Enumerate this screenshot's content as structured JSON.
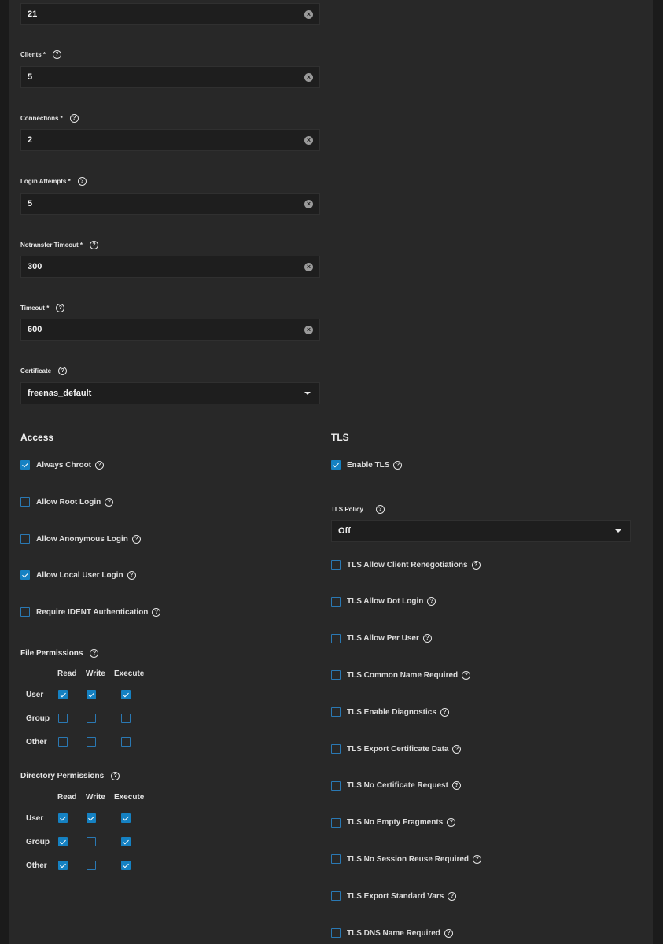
{
  "fields": {
    "port": {
      "value": "21"
    },
    "clients": {
      "label": "Clients *",
      "value": "5"
    },
    "connections": {
      "label": "Connections *",
      "value": "2"
    },
    "login_attempts": {
      "label": "Login Attempts *",
      "value": "5"
    },
    "notransfer_timeout": {
      "label": "Notransfer Timeout *",
      "value": "300"
    },
    "timeout": {
      "label": "Timeout *",
      "value": "600"
    },
    "certificate": {
      "label": "Certificate",
      "value": "freenas_default"
    }
  },
  "access": {
    "title": "Access",
    "always_chroot": {
      "label": "Always Chroot",
      "checked": true
    },
    "allow_root_login": {
      "label": "Allow Root Login",
      "checked": false
    },
    "allow_anonymous_login": {
      "label": "Allow Anonymous Login",
      "checked": false
    },
    "allow_local_user_login": {
      "label": "Allow Local User Login",
      "checked": true
    },
    "require_ident": {
      "label": "Require IDENT Authentication",
      "checked": false
    }
  },
  "file_permissions": {
    "label": "File Permissions",
    "columns": [
      "Read",
      "Write",
      "Execute"
    ],
    "rows": [
      {
        "name": "User",
        "values": [
          true,
          true,
          true
        ]
      },
      {
        "name": "Group",
        "values": [
          false,
          false,
          false
        ]
      },
      {
        "name": "Other",
        "values": [
          false,
          false,
          false
        ]
      }
    ]
  },
  "directory_permissions": {
    "label": "Directory Permissions",
    "columns": [
      "Read",
      "Write",
      "Execute"
    ],
    "rows": [
      {
        "name": "User",
        "values": [
          true,
          true,
          true
        ]
      },
      {
        "name": "Group",
        "values": [
          true,
          false,
          true
        ]
      },
      {
        "name": "Other",
        "values": [
          true,
          false,
          true
        ]
      }
    ]
  },
  "tls": {
    "title": "TLS",
    "enable_tls": {
      "label": "Enable TLS",
      "checked": true
    },
    "policy": {
      "label": "TLS Policy",
      "value": "Off"
    },
    "options": [
      {
        "label": "TLS Allow Client Renegotiations",
        "checked": false
      },
      {
        "label": "TLS Allow Dot Login",
        "checked": false
      },
      {
        "label": "TLS Allow Per User",
        "checked": false
      },
      {
        "label": "TLS Common Name Required",
        "checked": false
      },
      {
        "label": "TLS Enable Diagnostics",
        "checked": false
      },
      {
        "label": "TLS Export Certificate Data",
        "checked": false
      },
      {
        "label": "TLS No Certificate Request",
        "checked": false
      },
      {
        "label": "TLS No Empty Fragments",
        "checked": false
      },
      {
        "label": "TLS No Session Reuse Required",
        "checked": false
      },
      {
        "label": "TLS Export Standard Vars",
        "checked": false
      },
      {
        "label": "TLS DNS Name Required",
        "checked": false
      }
    ]
  },
  "icons": {
    "help": "help-circle-icon",
    "clear": "clear-circle-icon",
    "dropdown": "dropdown-arrow-icon"
  },
  "colors": {
    "background": "#1b1b1b",
    "panel": "#282828",
    "input": "#1e1e1e",
    "checkbox_accent": "#1581c2"
  }
}
